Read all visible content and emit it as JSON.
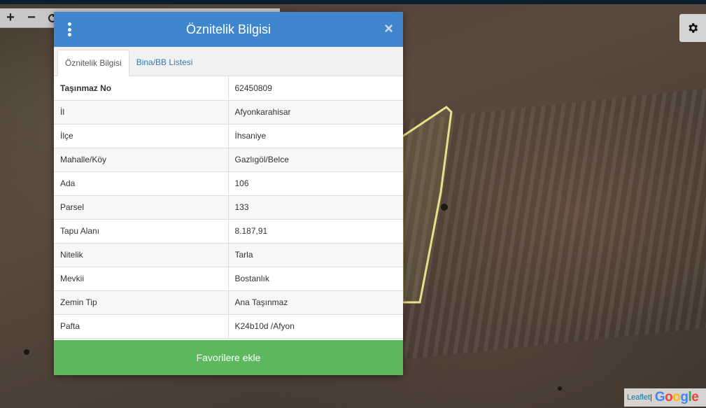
{
  "toolbar": {
    "zoom_in_label": "+",
    "zoom_out_label": "−"
  },
  "modal": {
    "title": "Öznitelik Bilgisi",
    "close_label": "×",
    "tabs": [
      {
        "label": "Öznitelik Bilgisi",
        "active": true
      },
      {
        "label": "Bina/BB Listesi",
        "active": false
      }
    ],
    "rows": [
      {
        "key": "Taşınmaz No",
        "value": "62450809"
      },
      {
        "key": "İl",
        "value": "Afyonkarahisar"
      },
      {
        "key": "İlçe",
        "value": "İhsaniye"
      },
      {
        "key": "Mahalle/Köy",
        "value": "Gazlıgöl/Belce"
      },
      {
        "key": "Ada",
        "value": "106"
      },
      {
        "key": "Parsel",
        "value": "133"
      },
      {
        "key": "Tapu Alanı",
        "value": "8.187,91"
      },
      {
        "key": "Nitelik",
        "value": "Tarla"
      },
      {
        "key": "Mevkii",
        "value": "Bostanlık"
      },
      {
        "key": "Zemin Tip",
        "value": "Ana Taşınmaz"
      },
      {
        "key": "Pafta",
        "value": "K24b10d /Afyon"
      }
    ],
    "favorite_button_label": "Favorilere ekle"
  },
  "attribution": {
    "leaflet_label": "Leaflet",
    "separator": " | ",
    "google_letters": [
      "G",
      "o",
      "o",
      "g",
      "l",
      "e"
    ]
  },
  "icons": {
    "menu": "vertical-dots-icon",
    "close": "close-icon",
    "settings": "gear-icon",
    "refresh": "refresh-icon"
  },
  "colors": {
    "header_blue": "#3f86cf",
    "favorite_green": "#5cb85c",
    "tab_link_blue": "#337ab7",
    "parcel_outline": "#e6e08a"
  }
}
